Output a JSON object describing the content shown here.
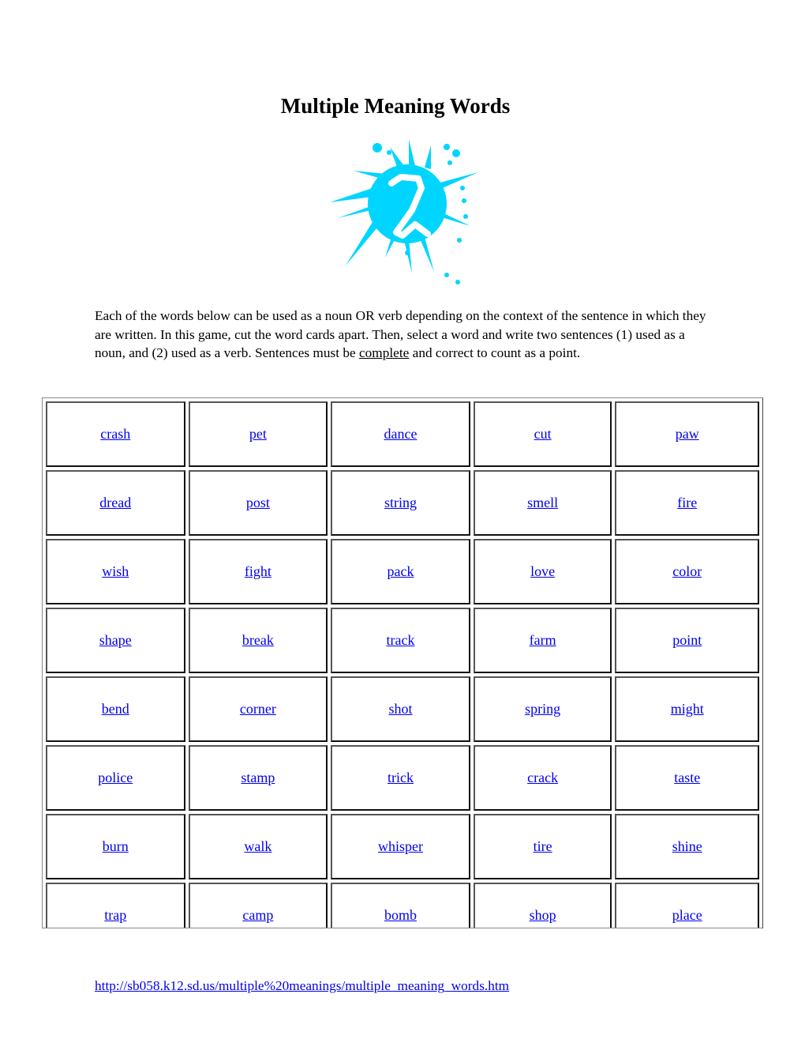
{
  "document": {
    "title": "Multiple Meaning Words",
    "image_icon": "paint-splat-number-2-icon",
    "accent_color": "#00d5ff",
    "intro": {
      "before_underline": "Each of the words below can be used as a noun OR verb depending on the context of the sentence in which they are written. In this game, cut the word cards apart. Then, select a word and write two sentences (1) used as a noun, and (2) used as a verb. Sentences must be ",
      "underlined": "complete",
      "after_underline": " and correct to count as a point."
    },
    "word_grid": [
      [
        "crash",
        "pet",
        "dance",
        "cut",
        "paw"
      ],
      [
        "dread",
        "post",
        "string",
        "smell",
        "fire"
      ],
      [
        "wish",
        "fight",
        "pack",
        "love",
        "color"
      ],
      [
        "shape",
        "break",
        "track",
        "farm",
        "point"
      ],
      [
        "bend",
        "corner",
        "shot",
        "spring",
        "might"
      ],
      [
        "police",
        "stamp",
        "trick",
        "crack",
        "taste"
      ],
      [
        "burn",
        "walk",
        "whisper",
        "tire",
        "shine"
      ],
      [
        "trap",
        "camp",
        "bomb",
        "shop",
        "place"
      ]
    ],
    "link_color": "#0000ee",
    "source_url": "http://sb058.k12.sd.us/multiple%20meanings/multiple_meaning_words.htm"
  }
}
